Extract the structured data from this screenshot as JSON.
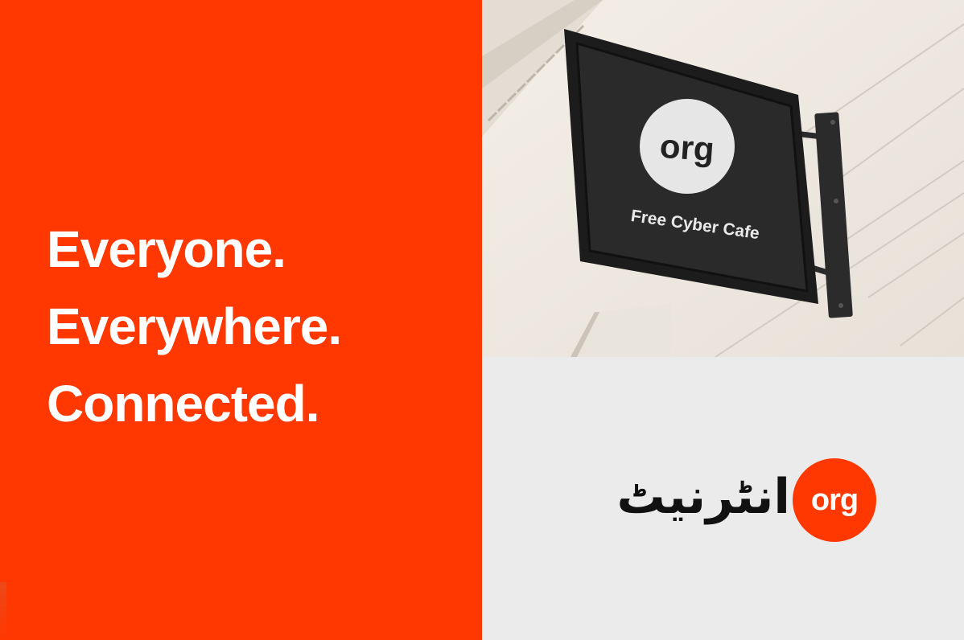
{
  "headline": {
    "line1": "Everyone.",
    "line2": "Everywhere.",
    "line3": "Connected."
  },
  "sign": {
    "logo_text": "org",
    "caption": "Free Cyber Cafe"
  },
  "brand_lockup": {
    "urdu_word": "انٹرنیٹ",
    "badge_text": "org"
  },
  "colors": {
    "brand_orange": "#ff3700",
    "light_panel": "#ebebeb",
    "sign_background": "#2a2a2a",
    "sign_logo_circle": "#e6e6e6"
  },
  "icons": {
    "sign": "hanging-sign-icon",
    "badge": "org-logo-badge"
  }
}
